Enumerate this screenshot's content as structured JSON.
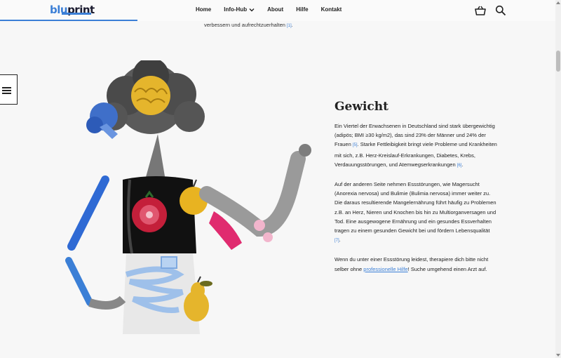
{
  "header": {
    "logo_part1": "blu",
    "logo_part2": "print",
    "nav": [
      {
        "label": "Home"
      },
      {
        "label": "Info-Hub"
      },
      {
        "label": "About"
      },
      {
        "label": "Hilfe"
      },
      {
        "label": "Kontakt"
      }
    ],
    "cart_icon": "basket-icon",
    "search_icon": "search-icon",
    "read_progress": 0.245
  },
  "lead_text": "verbessern und aufrechtzuerhalten",
  "lead_ref": "[1]",
  "toc_icon": "list-icon",
  "section": {
    "title": "Gewicht",
    "p1a": "Ein Viertel der Erwachsenen in Deutschland sind stark übergewichtig (adipös; BMI ≥30 kg/m2), das sind 23% der Männer und 24% der Frauen ",
    "p1_ref1": "[5]",
    "p1b": ". Starke Fettleibigkeit bringt viele Probleme und Krankheiten mit sich, z.B. Herz-Kreislauf-Erkrankungen, Diabetes, Krebs, Verdauungsstörungen, und Atemwegserkrankungen ",
    "p1_ref2": "[6]",
    "p1c": ".",
    "p2a": "Auf der anderen Seite nehmen Essstörungen, wie Magersucht (Anorexia nervosa) und Bulimie (Bulimia nervosa) immer weiter zu. Die daraus resultierende Mangelernährung führt häufig zu Problemen z.B. an Herz, Nieren und Knochen bis hin zu Multiorganversagen und Tod. Eine ausgewogene Ernährung und ein gesundes Essverhalten tragen zu einem gesunden Gewicht bei und fördern Lebensqualität ",
    "p2_ref": "[7]",
    "p2c": ".",
    "p3a": "Wenn du unter einer Essstörung leidest, therapiere dich bitte nicht selber ohne ",
    "p3_link": "professionelle Hilfe",
    "p3b": "! Suche umgehend einen Arzt auf."
  },
  "colors": {
    "accent": "#3b7fd6"
  }
}
